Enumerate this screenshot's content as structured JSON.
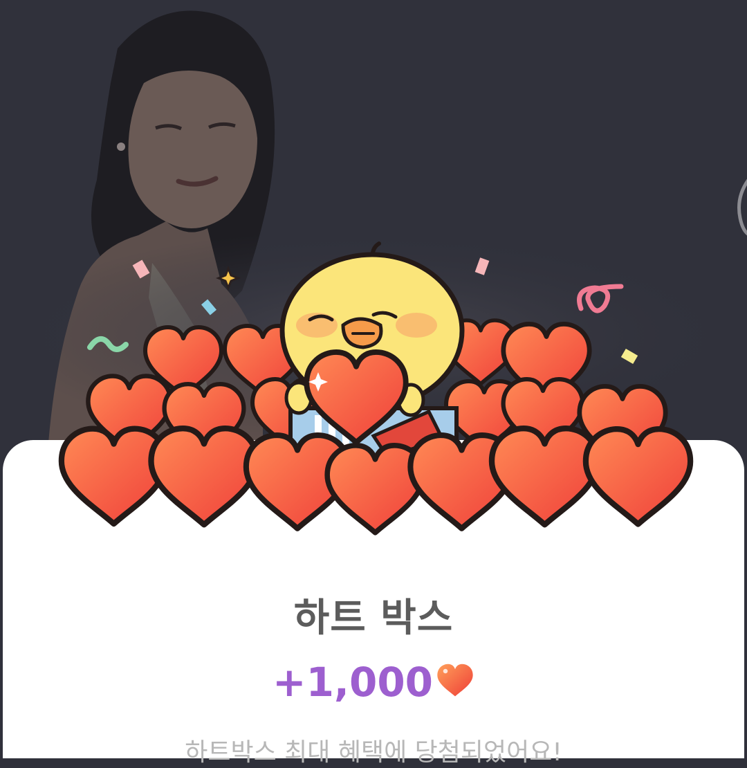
{
  "popup": {
    "title": "하트 박스",
    "reward_amount": "+1,000",
    "reward_icon": "heart-icon",
    "subtitle": "하트박스 최대 혜택에 당첨되었어요!"
  },
  "colors": {
    "background": "#30313b",
    "sheet": "#ffffff",
    "title": "#5c5c5c",
    "reward": "#9d5fcf",
    "heart_fill": "#f25a3c"
  }
}
